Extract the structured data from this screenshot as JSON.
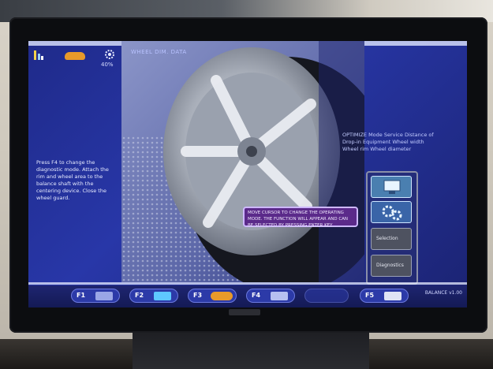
{
  "screen": {
    "header_text": "WHEEL DIM. DATA",
    "status_level": "40%",
    "instructions": "Press F4 to change the diagnostic mode. Attach the rim and wheel area to the balance shaft with the centering device. Close the wheel guard.",
    "right_info": "OPTIMIZE Mode Service Distance of Drop-in Equipment Wheel width Wheel rim Wheel diameter",
    "tooltip": "MOVE CURSOR TO CHANGE THE OPERATING MODE. THE FUNCTION WILL APPEAR AND CAN BE SELECTED BY PRESSING ENTER KEY",
    "side_buttons": [
      "",
      "",
      "Selection",
      "Diagnostics"
    ],
    "function_keys": [
      "F1",
      "F2",
      "F3",
      "F4",
      "",
      "F5"
    ],
    "version": "BALANCE v1.00"
  },
  "colors": {
    "screen_bg": "#2837a8",
    "accent_orange": "#e89a2a",
    "tooltip_bg": "#5b2a8a"
  }
}
